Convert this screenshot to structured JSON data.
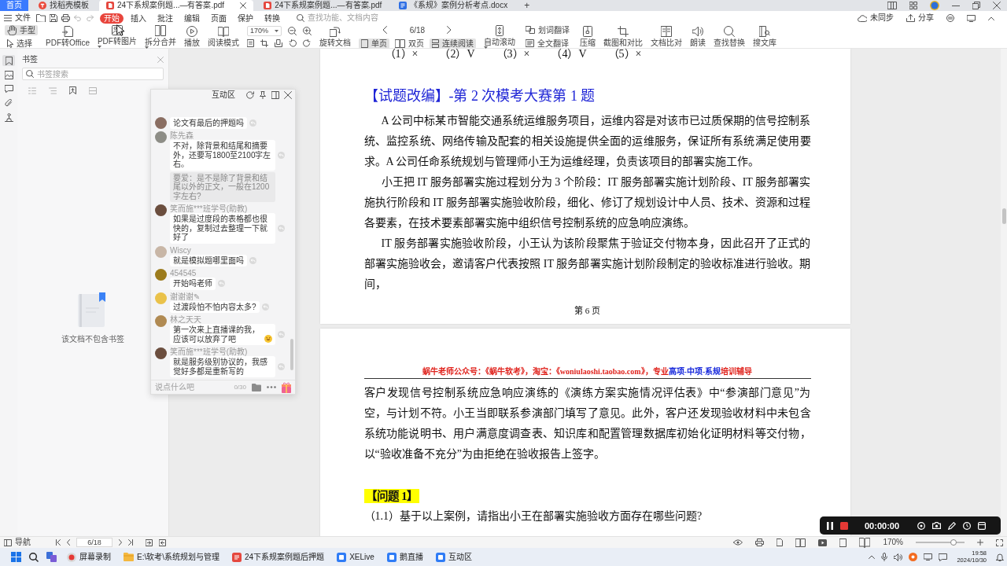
{
  "window": {
    "tabs": [
      {
        "label": "首页",
        "kind": "home",
        "selected": false
      },
      {
        "label": "找稻壳模板",
        "kind": "web",
        "selected": false
      },
      {
        "label": "24下系规案例题...—有答案.pdf",
        "kind": "pdf",
        "selected": true
      },
      {
        "label": "24下系规案例题...—有答案.pdf",
        "kind": "pdf",
        "selected": false
      },
      {
        "label": "《系规》案例分析考点.docx",
        "kind": "doc",
        "selected": false
      }
    ],
    "new_tab": "+"
  },
  "menu": {
    "file": "文件",
    "tabs": [
      {
        "label": "开始",
        "selected": true
      },
      {
        "label": "插入",
        "selected": false
      },
      {
        "label": "批注",
        "selected": false
      },
      {
        "label": "编辑",
        "selected": false
      },
      {
        "label": "页面",
        "selected": false
      },
      {
        "label": "保护",
        "selected": false
      },
      {
        "label": "转换",
        "selected": false
      }
    ],
    "search": {
      "placeholder": "查找功能、文档内容"
    },
    "sync": "未同步",
    "share": "分享"
  },
  "toolbar": {
    "items": [
      {
        "kind": "stack",
        "rows": [
          {
            "label": "手型",
            "selected": true
          },
          {
            "label": "选择",
            "selected": false
          }
        ]
      },
      {
        "kind": "button",
        "label": "PDF转Office",
        "dropdown": false
      },
      {
        "kind": "button",
        "label": "PDF转图片",
        "dropdown": true
      },
      {
        "kind": "button",
        "label": "拆分合并",
        "dropdown": true
      },
      {
        "kind": "button",
        "label": "播放",
        "dropdown": false
      },
      {
        "kind": "button",
        "label": "阅读模式",
        "dropdown": false
      },
      {
        "kind": "zoom",
        "value": "170%"
      },
      {
        "kind": "button",
        "label": "旋转文档",
        "dropdown": false
      },
      {
        "kind": "pager",
        "value": "6/18",
        "views": [
          {
            "label": "单页",
            "selected": true
          },
          {
            "label": "双页",
            "selected": false
          },
          {
            "label": "连续阅读",
            "selected": true
          }
        ]
      },
      {
        "kind": "button",
        "label": "自动滚动",
        "dropdown": true
      },
      {
        "kind": "stack",
        "rows": [
          {
            "label": "划词翻译",
            "selected": false
          },
          {
            "label": "全文翻译",
            "selected": false
          }
        ]
      },
      {
        "kind": "button",
        "label": "压缩",
        "dropdown": false
      },
      {
        "kind": "button",
        "label": "截图和对比",
        "dropdown": false
      },
      {
        "kind": "button",
        "label": "文档比对",
        "dropdown": false
      },
      {
        "kind": "button",
        "label": "朗读",
        "dropdown": false
      },
      {
        "kind": "button",
        "label": "查找替换",
        "dropdown": false
      },
      {
        "kind": "button",
        "label": "搜文库",
        "dropdown": false
      }
    ]
  },
  "sidebar": {
    "rail": [
      {
        "selected": true
      },
      {
        "selected": false
      },
      {
        "selected": false
      },
      {
        "selected": false
      },
      {
        "selected": false
      }
    ],
    "panel": {
      "title": "书签",
      "search": {
        "placeholder": "书签搜索"
      },
      "empty_text": "该文档不包含书签"
    }
  },
  "chat": {
    "title": "互动区",
    "messages": [
      {
        "text": "论文有最后的押题吗",
        "color": "#8a6e62",
        "emoji": false
      },
      {
        "name": "陈先森",
        "text": "不对，除背景和结尾和摘要外，还要写1800至2100字左右。",
        "quote": "要爱：是不是除了背景和结尾以外的正文，一般在1200字左右?",
        "color": "#8d8d86",
        "emoji": false
      },
      {
        "name": "笑而施***班学号(助教)",
        "text": "如果是过度段的表格都也很快的，复制过去整理一下就好了",
        "color": "#6b4e3e",
        "emoji": false
      },
      {
        "name": "Wiscy",
        "text": "就是模拟题哪里面吗",
        "color": "#c8b6a6",
        "emoji": false
      },
      {
        "name": "454545",
        "text": "开始吗老师",
        "color": "#9c7b1c",
        "emoji": false
      },
      {
        "name": "谢谢谢✎",
        "text": "过渡段怕不怕内容太多?",
        "color": "#eac24a",
        "emoji": false
      },
      {
        "name": "林之天天",
        "text": "第一次来上直播课的我，应该可以放弃了吧",
        "color": "#b08a52",
        "emoji": true
      },
      {
        "name": "笑而施***班学号(助教)",
        "text": "就是服务级别协议的，我感觉好多都是重新写的",
        "color": "#6b4e3e",
        "emoji": false
      }
    ],
    "input": {
      "placeholder": "说点什么吧"
    },
    "counter": "0/30"
  },
  "document": {
    "page1": {
      "answers": [
        "（1）×",
        "（2）V",
        "（3）×",
        "（4）V",
        "（5）×"
      ],
      "heading": "【试题改编】-第 2 次模考大赛第 1 题",
      "paragraphs": [
        "A 公司中标某市智能交通系统运维服务项目，运维内容是对该市已过质保期的信号控制系统、监控系统、网络传输及配套的相关设施提供全面的运维服务，保证所有系统满足使用要求。A 公司任命系统规划与管理师小王为运维经理，负责该项目的部署实施工作。",
        "小王把 IT 服务部署实施过程划分为 3 个阶段：IT 服务部署实施计划阶段、IT 服务部署实施执行阶段和 IT 服务部署实施验收阶段，细化、修订了规划设计中人员、技术、资源和过程各要素，在技术要素部署实施中组织信号控制系统的应急响应演练。",
        "IT 服务部署实施验收阶段，小王认为该阶段聚焦于验证交付物本身，因此召开了正式的部署实施验收会，邀请客户代表按照 IT 服务部署实施计划阶段制定的验收标准进行验收。期间，"
      ],
      "footer": "第 6 页"
    },
    "page2": {
      "header": {
        "segments": [
          {
            "text": "蜗牛老师公众号：《蜗牛软考》，淘宝：《woniulaoshi.taobao.com》，专业",
            "kind": "plain"
          },
          {
            "text": "高项-中项-系规",
            "kind": "accent"
          },
          {
            "text": "培训辅导",
            "kind": "plain"
          }
        ]
      },
      "paragraphs": [
        "客户发现信号控制系统应急响应演练的《演练方案实施情况评估表》中“参演部门意见”为空，与计划不符。小王当即联系参演部门填写了意见。此外，客户还发现验收材料中未包含系统功能说明书、用户满意度调查表、知识库和配置管理数据库初始化证明材料等交付物，以“验收准备不充分”为由拒绝在验收报告上签字。"
      ],
      "question": {
        "label": "【问题 1】",
        "text": "（1.1）基于以上案例，请指出小王在部署实施验收方面存在哪些问题?"
      }
    }
  },
  "recorder": {
    "time": "00:00:00"
  },
  "status_bar": {
    "nav": "导航",
    "page": "6/18",
    "zoom": "170%",
    "zoom_slider": {
      "level": 0.78
    }
  },
  "taskbar": {
    "apps": [
      {
        "label": "屏幕录制",
        "kind": "record"
      },
      {
        "label": "E:\\软考\\系统规划与管理",
        "kind": "folder"
      },
      {
        "label": "24下系规案例题后押题",
        "kind": "wps"
      },
      {
        "label": "XELive",
        "kind": "live"
      },
      {
        "label": "鹅直播",
        "kind": "live"
      },
      {
        "label": "互动区",
        "kind": "live"
      }
    ],
    "time": "19:58",
    "date": "2024/10/30"
  }
}
